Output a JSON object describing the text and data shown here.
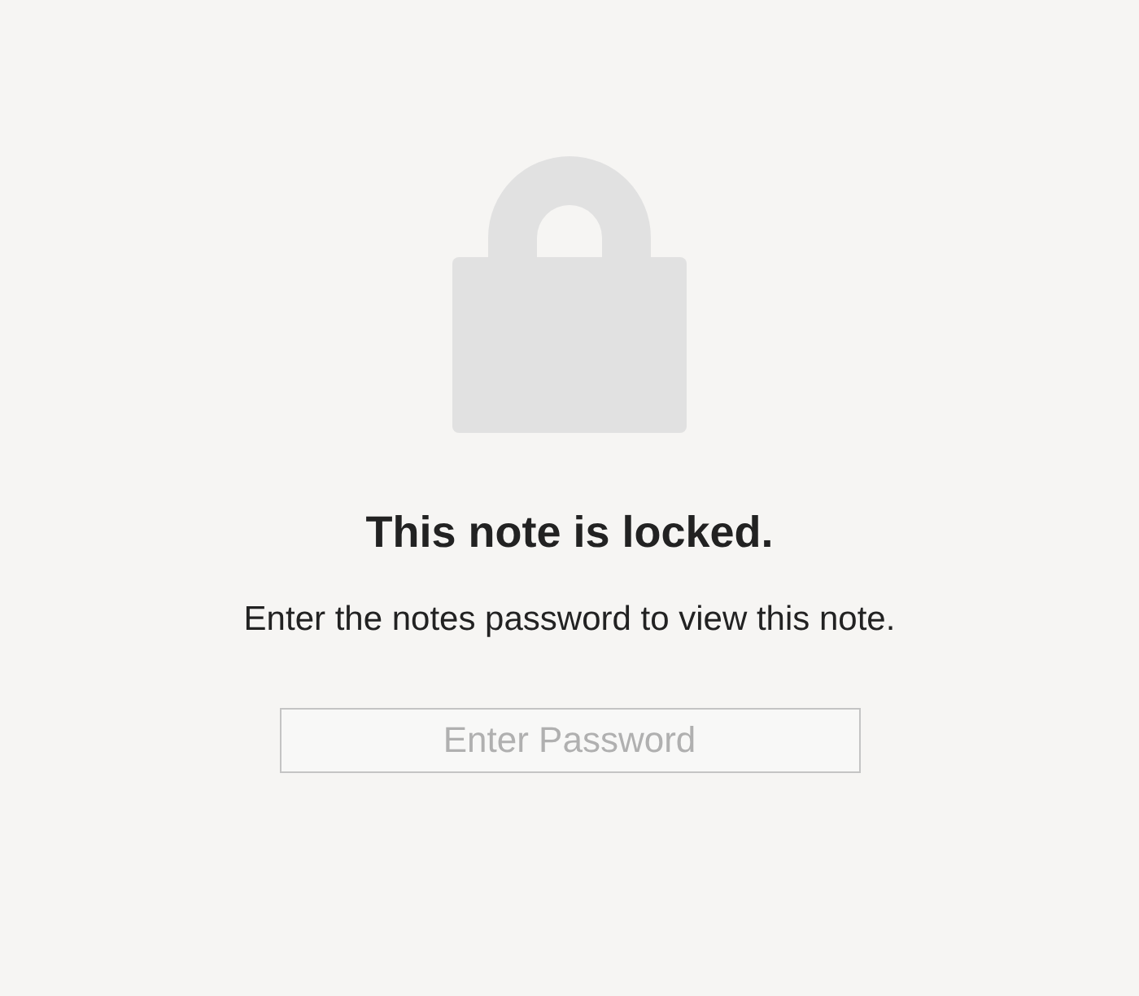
{
  "title": "This note is locked.",
  "message": "Enter the notes password to view this note.",
  "password_field": {
    "placeholder": "Enter Password"
  }
}
